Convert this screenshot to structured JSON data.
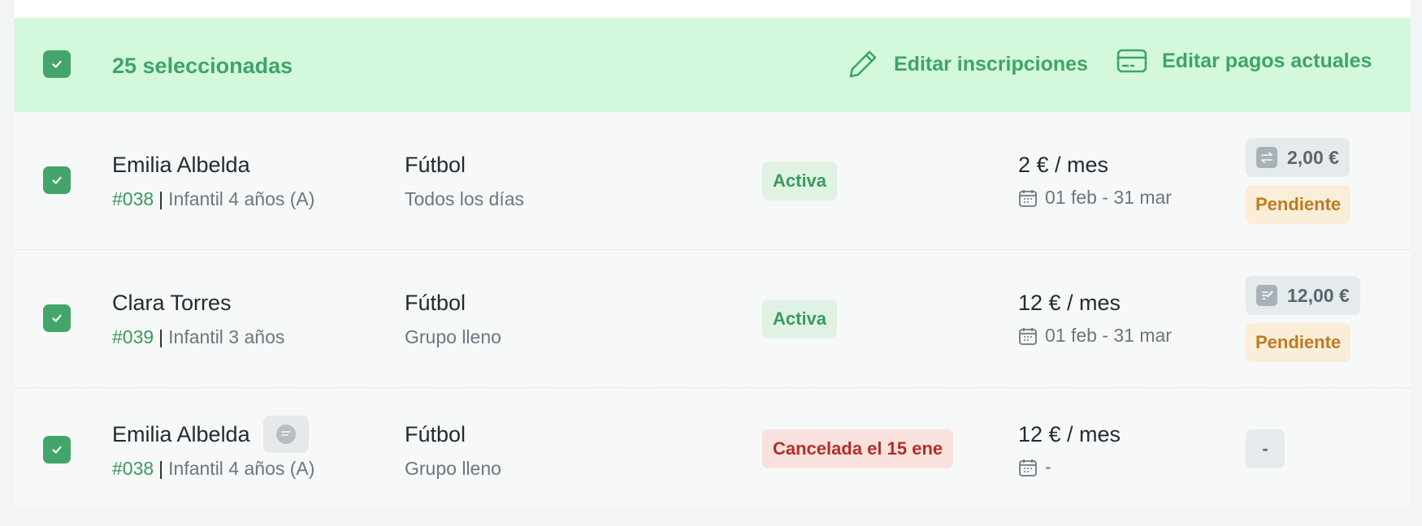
{
  "selection": {
    "count_label": "25 seleccionadas"
  },
  "actions": {
    "edit_enrollments": "Editar inscripciones",
    "edit_payments": "Editar pagos actuales"
  },
  "rows": [
    {
      "name": "Emilia Albelda",
      "code": "#038",
      "group": "Infantil 4 años (A)",
      "activity": "Fútbol",
      "schedule": "Todos los días",
      "status": "Activa",
      "price": "2 € / mes",
      "dates": "01 feb - 31 mar",
      "amount": "2,00 €",
      "payment_status": "Pendiente"
    },
    {
      "name": "Clara Torres",
      "code": "#039",
      "group": "Infantil 3 años",
      "activity": "Fútbol",
      "schedule": "Grupo lleno",
      "status": "Activa",
      "price": "12 € / mes",
      "dates": "01 feb - 31 mar",
      "amount": "12,00 €",
      "payment_status": "Pendiente"
    },
    {
      "name": "Emilia Albelda",
      "code": "#038",
      "group": "Infantil 4 años (A)",
      "activity": "Fútbol",
      "schedule": "Grupo lleno",
      "status": "Cancelada el 15 ene",
      "price": "12 € / mes",
      "dates": "-",
      "payment": "-"
    }
  ],
  "colors": {
    "accent": "#3fa566",
    "selection_bg": "#d3f8dc",
    "pending": "#c07a22",
    "cancelled": "#b13028"
  }
}
